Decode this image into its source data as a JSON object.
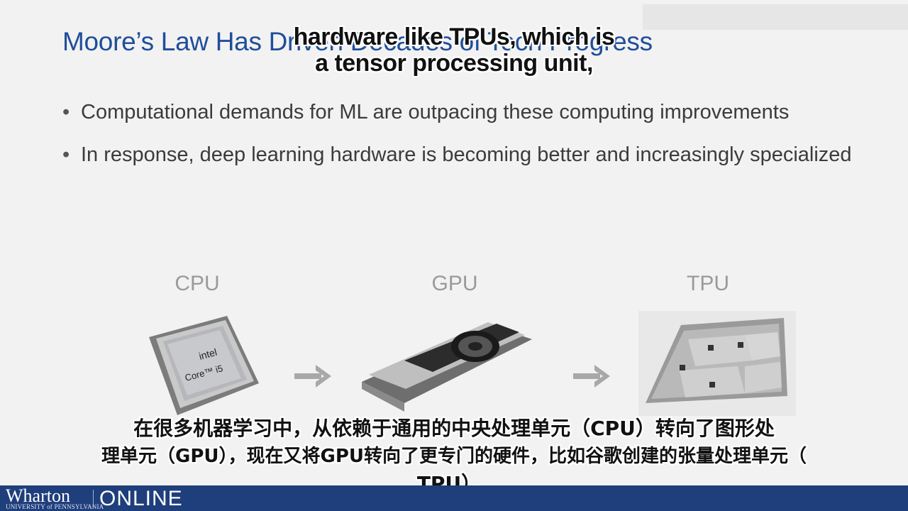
{
  "slide": {
    "title": "Moore’s Law Has Driven Decades of Tech Progress",
    "bullets": [
      "Computational demands for ML are outpacing these computing improvements",
      "In response, deep learning hardware is becoming better and increasingly specialized"
    ],
    "hardware": {
      "cpu_label": "CPU",
      "gpu_label": "GPU",
      "tpu_label": "TPU",
      "cpu_chip_text_brand": "intel",
      "cpu_chip_text_model": "Core™ i5"
    }
  },
  "subtitles": {
    "english_line1": "hardware like TPUs, which is",
    "english_line2": "a tensor processing unit,",
    "chinese_line1": "在很多机器学习中，从依赖于通用的中央处理单元（CPU）转向了图形处",
    "chinese_line2": "理单元（GPU），现在又将GPU转向了更专门的硬件，比如谷歌创建的张量处理单元（",
    "chinese_line3": "TPU）。"
  },
  "footer": {
    "brand": "Wharton",
    "university": "UNIVERSITY of PENNSYLVANIA",
    "online": "ONLINE"
  },
  "colors": {
    "title": "#1f4e9a",
    "footer_bg": "#1f3e7c",
    "body_text": "#3b3b3b",
    "label_gray": "#9a9a9a"
  }
}
